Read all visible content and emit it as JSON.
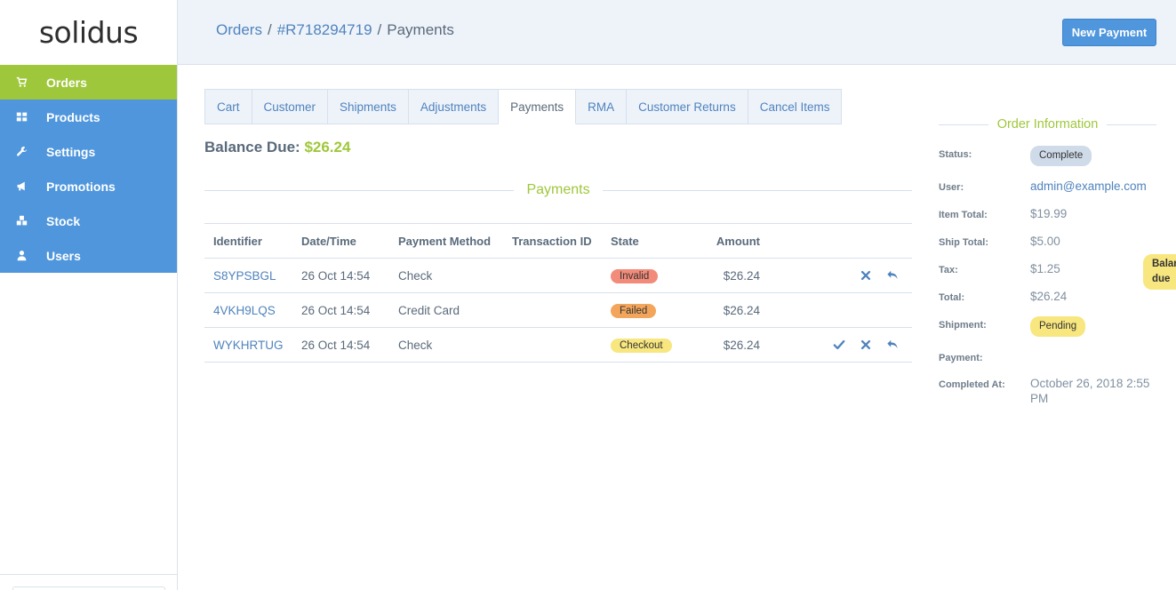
{
  "brand": {
    "logo_text": "solidus"
  },
  "sidebar": {
    "items": [
      {
        "label": "Orders",
        "icon": "cart-icon",
        "active": true
      },
      {
        "label": "Products",
        "icon": "grid-icon"
      },
      {
        "label": "Settings",
        "icon": "wrench-icon"
      },
      {
        "label": "Promotions",
        "icon": "megaphone-icon"
      },
      {
        "label": "Stock",
        "icon": "cubes-icon"
      },
      {
        "label": "Users",
        "icon": "user-icon"
      }
    ]
  },
  "header": {
    "breadcrumb": [
      "Orders",
      "#R718294719",
      "Payments"
    ],
    "separator": "/",
    "new_payment_label": "New Payment"
  },
  "tabs": [
    "Cart",
    "Customer",
    "Shipments",
    "Adjustments",
    "Payments",
    "RMA",
    "Customer Returns",
    "Cancel Items"
  ],
  "active_tab": "Payments",
  "balance": {
    "label": "Balance Due:",
    "amount": "$26.24"
  },
  "payments": {
    "section_title": "Payments",
    "columns": [
      "Identifier",
      "Date/Time",
      "Payment Method",
      "Transaction ID",
      "State",
      "Amount"
    ],
    "rows": [
      {
        "identifier": "S8YPSBGL",
        "datetime": "26 Oct 14:54",
        "method": "Check",
        "transaction_id": "",
        "state": "Invalid",
        "amount": "$26.24",
        "actions": [
          "void-icon",
          "refund-icon"
        ]
      },
      {
        "identifier": "4VKH9LQS",
        "datetime": "26 Oct 14:54",
        "method": "Credit Card",
        "transaction_id": "",
        "state": "Failed",
        "amount": "$26.24",
        "actions": []
      },
      {
        "identifier": "WYKHRTUG",
        "datetime": "26 Oct 14:54",
        "method": "Check",
        "transaction_id": "",
        "state": "Checkout",
        "amount": "$26.24",
        "actions": [
          "capture-icon",
          "void-icon",
          "refund-icon"
        ]
      }
    ]
  },
  "order_info": {
    "title": "Order Information",
    "status_label": "Status:",
    "status": "Complete",
    "user_label": "User:",
    "user": "admin@example.com",
    "item_total_label": "Item Total:",
    "item_total": "$19.99",
    "ship_total_label": "Ship Total:",
    "ship_total": "$5.00",
    "tax_label": "Tax:",
    "tax": "$1.25",
    "total_label": "Total:",
    "total": "$26.24",
    "shipment_label": "Shipment:",
    "shipment": "Pending",
    "payment_label": "Payment:",
    "payment": "Balance due",
    "completed_at_label": "Completed At:",
    "completed_at": "October 26, 2018 2:55 PM"
  },
  "colors": {
    "primary": "#4f96dc",
    "accent_green": "#9fc73b",
    "link": "#4f83bd",
    "state_invalid": "#f28b7a",
    "state_failed": "#f3a65b",
    "state_checkout": "#f8e67f"
  }
}
